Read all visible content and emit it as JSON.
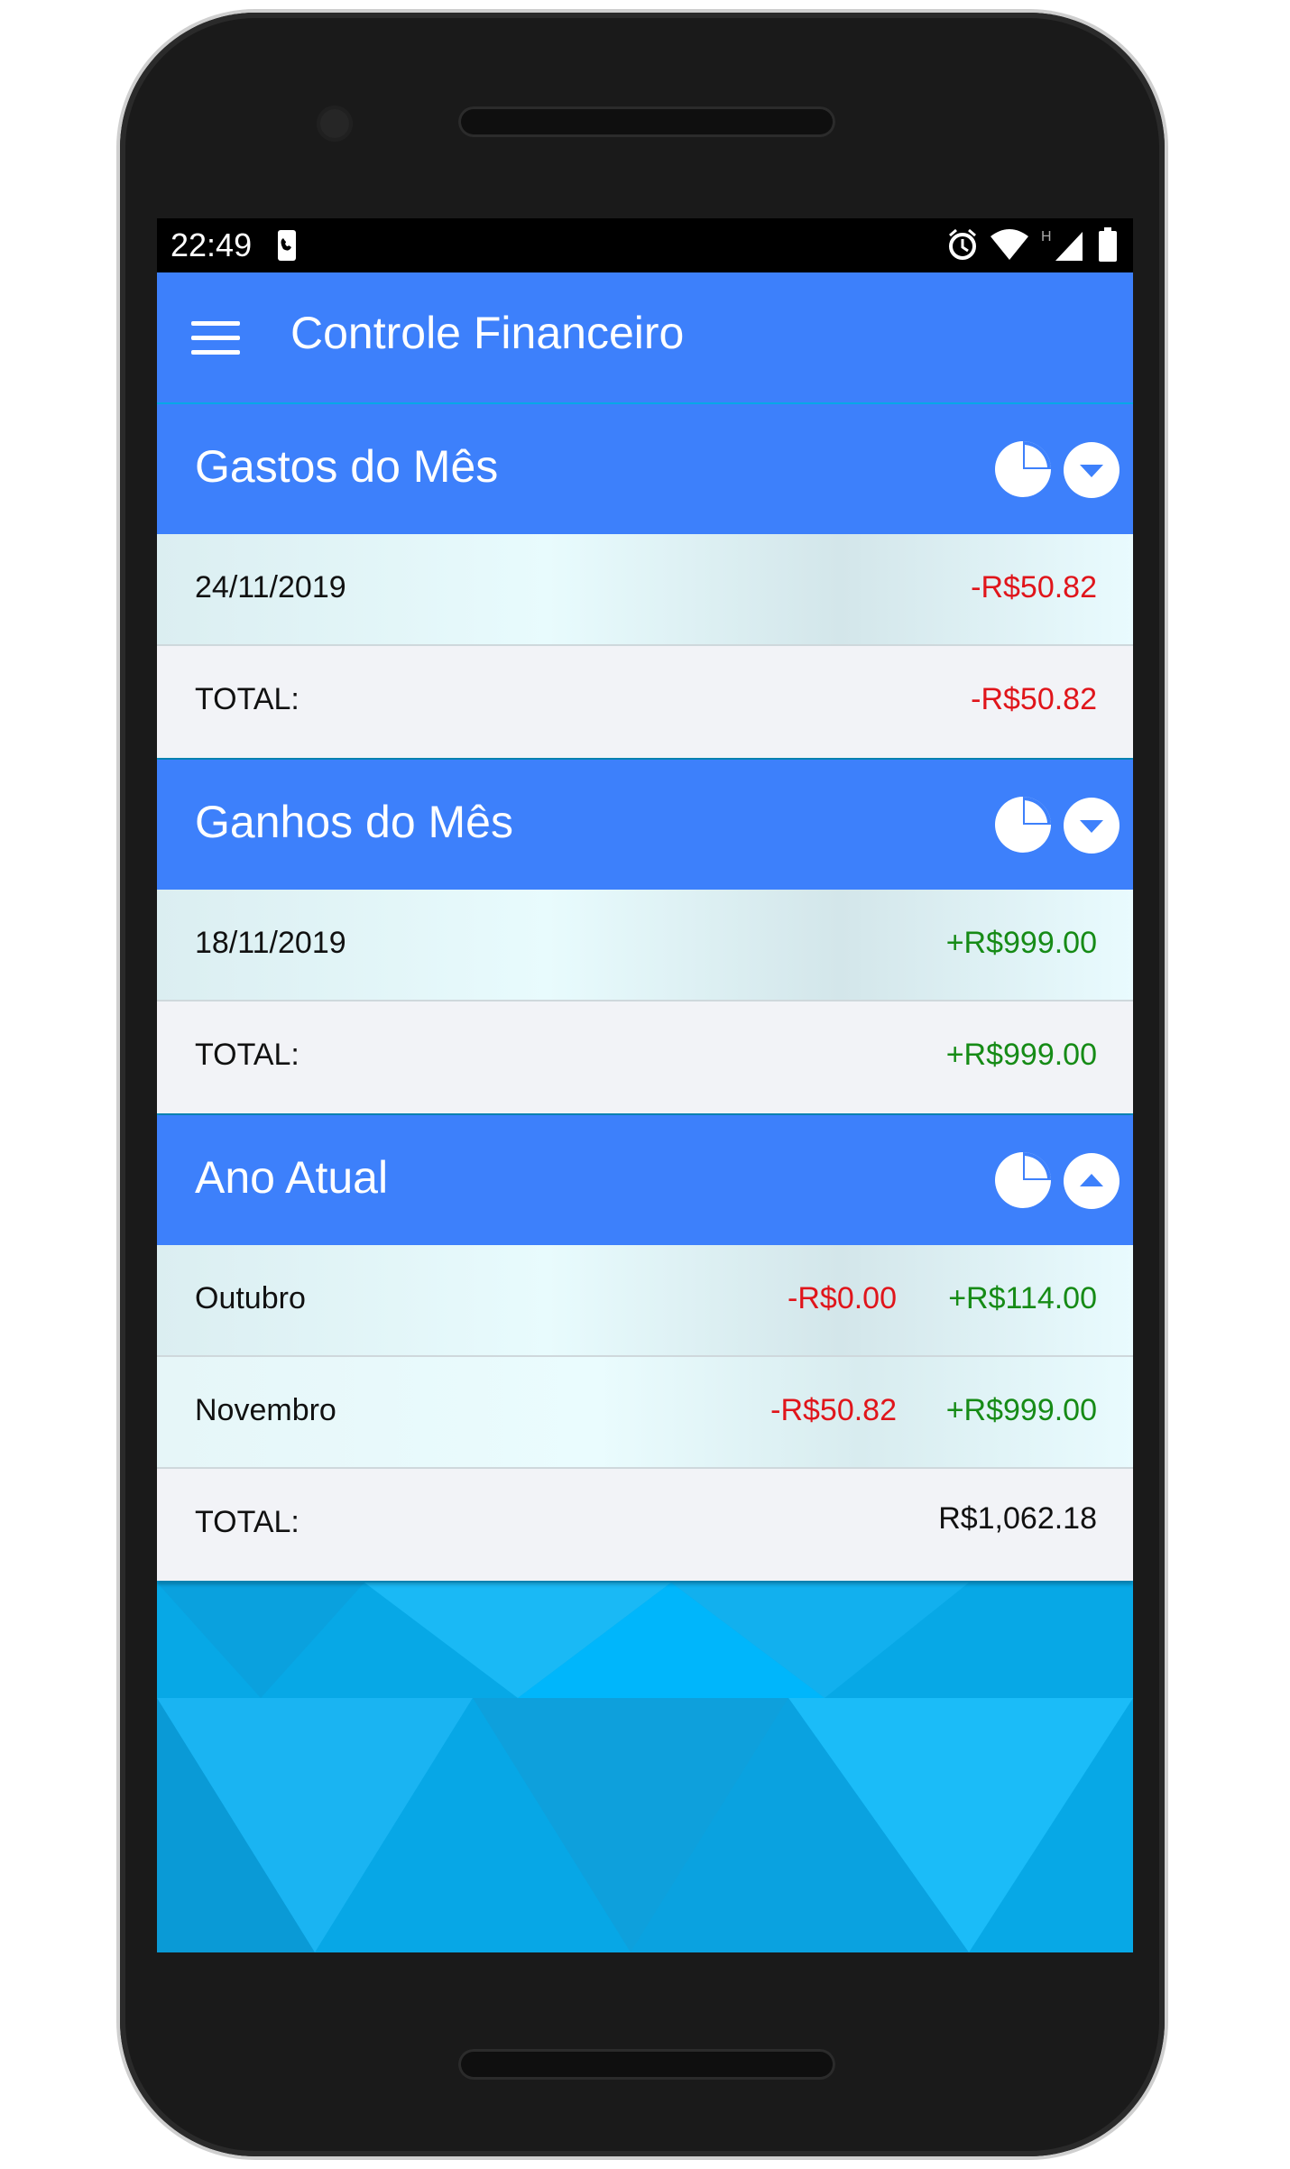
{
  "status_bar": {
    "time": "22:49"
  },
  "app_bar": {
    "title": "Controle Financeiro"
  },
  "sections": [
    {
      "title": "Gastos do Mês",
      "toggle_state": "collapsed",
      "rows": [
        {
          "label": "24/11/2019",
          "value": "-R$50.82"
        }
      ],
      "total": {
        "label": "TOTAL:",
        "value": "-R$50.82"
      }
    },
    {
      "title": "Ganhos do Mês",
      "toggle_state": "collapsed",
      "rows": [
        {
          "label": "18/11/2019",
          "value": "+R$999.00"
        }
      ],
      "total": {
        "label": "TOTAL:",
        "value": "+R$999.00"
      }
    },
    {
      "title": "Ano Atual",
      "toggle_state": "expanded",
      "rows": [
        {
          "label": "Outubro",
          "expense": "-R$0.00",
          "income": "+R$114.00"
        },
        {
          "label": "Novembro",
          "expense": "-R$50.82",
          "income": "+R$999.00"
        }
      ],
      "total": {
        "label": "TOTAL:",
        "value": "R$1,062.18"
      }
    }
  ],
  "colors": {
    "primary": "#3d80fb",
    "negative": "#e0151b",
    "positive": "#168b16",
    "background_blue": "#05a7e8",
    "row_background": "#e6f9fc",
    "total_background": "#f2f3f7"
  },
  "icons": [
    "menu-icon",
    "pie-chart-icon",
    "chevron-down-icon",
    "chevron-up-icon",
    "alarm-icon",
    "wifi-icon",
    "signal-icon",
    "battery-icon",
    "phone-notification-icon"
  ]
}
